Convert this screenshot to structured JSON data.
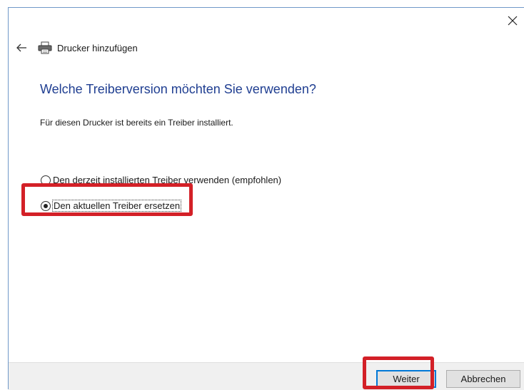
{
  "window": {
    "title": "Drucker hinzufügen",
    "close_icon": "close-icon",
    "back_icon": "back-arrow-icon",
    "printer_icon": "printer-icon"
  },
  "main": {
    "heading": "Welche Treiberversion möchten Sie verwenden?",
    "info": "Für diesen Drucker ist bereits ein Treiber installiert.",
    "options": [
      {
        "label": "Den derzeit installierten Treiber verwenden (empfohlen)",
        "selected": false
      },
      {
        "label": "Den aktuellen Treiber ersetzen",
        "selected": true
      }
    ]
  },
  "footer": {
    "next_label": "Weiter",
    "cancel_label": "Abbrechen"
  },
  "colors": {
    "heading": "#1f3e91",
    "highlight": "#d32027",
    "focus_border": "#0078d7"
  }
}
